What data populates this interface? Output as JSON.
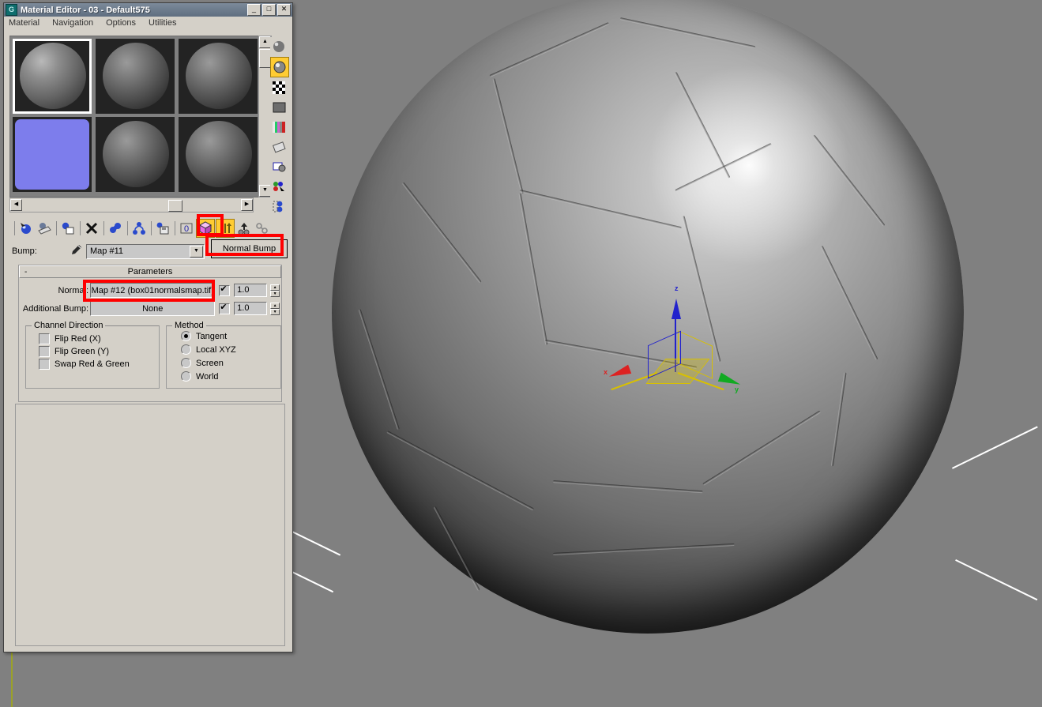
{
  "window": {
    "title": "Material Editor - 03 - Default575",
    "app_icon": "material-editor-icon",
    "minimize": "_",
    "maximize": "□",
    "close": "✕"
  },
  "menu": {
    "items": [
      "Material",
      "Navigation",
      "Options",
      "Utilities"
    ]
  },
  "slots": [
    {
      "name": "slot-1",
      "type": "faceted-ball",
      "selected": true
    },
    {
      "name": "slot-2",
      "type": "ball",
      "selected": false
    },
    {
      "name": "slot-3",
      "type": "ball",
      "selected": false
    },
    {
      "name": "slot-4",
      "type": "normal-map-swatch",
      "selected": false,
      "color": "#7d7dec"
    },
    {
      "name": "slot-5",
      "type": "ball",
      "selected": false
    },
    {
      "name": "slot-6",
      "type": "ball",
      "selected": false
    }
  ],
  "vertical_toolbar": [
    {
      "icon": "sample-type-sphere-icon",
      "active": false
    },
    {
      "icon": "backlight-icon",
      "active": true
    },
    {
      "icon": "background-checker-icon",
      "active": false
    },
    {
      "icon": "sample-uv-tiling-icon",
      "active": false
    },
    {
      "icon": "video-color-check-icon",
      "active": false
    },
    {
      "icon": "make-preview-icon",
      "active": false
    },
    {
      "icon": "options-icon",
      "active": false
    },
    {
      "icon": "select-by-material-icon",
      "active": false
    },
    {
      "icon": "material-map-navigator-icon",
      "active": false
    }
  ],
  "toolbar": [
    {
      "icon": "get-material-icon",
      "active": false
    },
    {
      "icon": "put-material-to-scene-icon",
      "active": false
    },
    {
      "icon": "assign-material-to-selection-icon",
      "active": false
    },
    {
      "icon": "reset-map-material-icon",
      "active": false
    },
    {
      "icon": "make-material-copy-icon",
      "active": false
    },
    {
      "icon": "make-unique-icon",
      "active": false
    },
    {
      "icon": "put-to-library-icon",
      "active": false
    },
    {
      "icon": "material-id-channel-icon",
      "active": false,
      "label": "0"
    },
    {
      "icon": "show-map-in-viewport-icon",
      "active": true
    },
    {
      "icon": "show-end-result-icon",
      "active": true
    },
    {
      "icon": "go-to-parent-icon",
      "active": false
    },
    {
      "icon": "go-forward-to-sibling-icon",
      "active": false
    }
  ],
  "bump_row": {
    "label": "Bump:",
    "eyedropper_icon": "eyedropper-icon",
    "map_name": "Map #11",
    "dropdown_arrow": "▼"
  },
  "normal_bump_tooltip": "Normal Bump",
  "rollout": {
    "collapse_glyph": "-",
    "title": "Parameters",
    "normal": {
      "label": "Normal:",
      "map": "Map #12 (box01normalsmap.tif)",
      "enabled": true,
      "amount": "1.0"
    },
    "additional_bump": {
      "label": "Additional Bump:",
      "map": "None",
      "enabled": true,
      "amount": "1.0"
    },
    "channel_direction": {
      "title": "Channel Direction",
      "options": [
        {
          "label": "Flip Red (X)",
          "checked": false
        },
        {
          "label": "Flip Green (Y)",
          "checked": false
        },
        {
          "label": "Swap Red & Green",
          "checked": false
        }
      ]
    },
    "method": {
      "title": "Method",
      "options": [
        {
          "label": "Tangent",
          "selected": true
        },
        {
          "label": "Local XYZ",
          "selected": false
        },
        {
          "label": "Screen",
          "selected": false
        },
        {
          "label": "World",
          "selected": false
        }
      ]
    }
  },
  "viewport": {
    "background_color": "#808080",
    "object": "soccer-ball",
    "gizmo": {
      "axes": [
        {
          "name": "x-axis",
          "label": "x",
          "color": "#dd2222"
        },
        {
          "name": "y-axis",
          "label": "y",
          "color": "#11aa22"
        },
        {
          "name": "z-axis",
          "label": "z",
          "color": "#2222cc"
        }
      ],
      "plane_handle_color": "#d8c000"
    }
  },
  "annotations": [
    {
      "name": "highlight-show-map-button"
    },
    {
      "name": "highlight-normal-bump-tooltip"
    },
    {
      "name": "highlight-normal-map-field"
    }
  ],
  "scroll": {
    "left_arrow": "◀",
    "right_arrow": "▶",
    "up_arrow": "▲",
    "down_arrow": "▼"
  }
}
